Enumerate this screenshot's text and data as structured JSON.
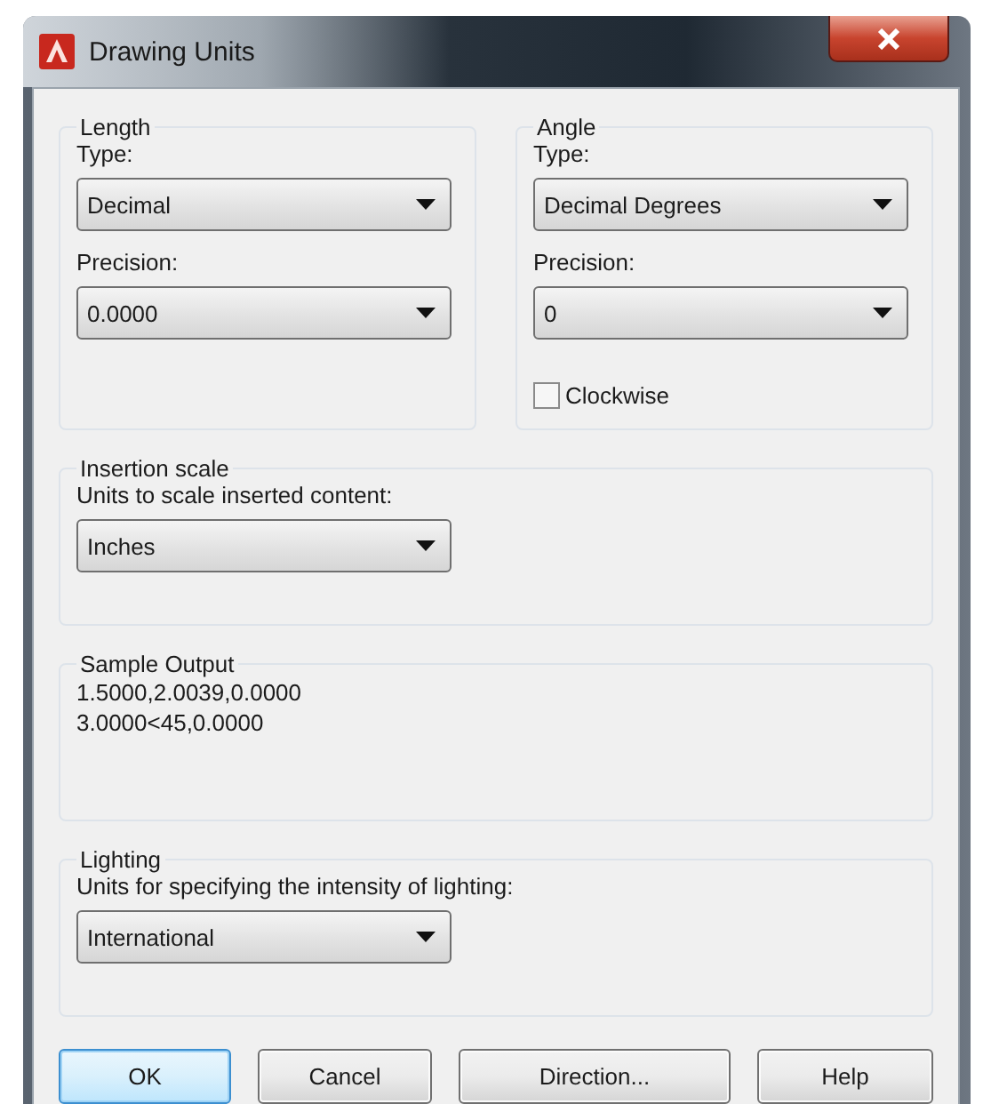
{
  "window": {
    "title": "Drawing Units"
  },
  "length": {
    "heading": "Length",
    "type_label": "Type:",
    "type_value": "Decimal",
    "precision_label": "Precision:",
    "precision_value": "0.0000"
  },
  "angle": {
    "heading": "Angle",
    "type_label": "Type:",
    "type_value": "Decimal Degrees",
    "precision_label": "Precision:",
    "precision_value": "0",
    "clockwise": {
      "label": "Clockwise",
      "checked": false
    }
  },
  "insertion_scale": {
    "heading": "Insertion scale",
    "label": "Units to scale inserted content:",
    "value": "Inches"
  },
  "sample_output": {
    "heading": "Sample Output",
    "lines": [
      "1.5000,2.0039,0.0000",
      "3.0000<45,0.0000"
    ]
  },
  "lighting": {
    "heading": "Lighting",
    "label": "Units for specifying the intensity of lighting:",
    "value": "International"
  },
  "buttons": [
    {
      "label": "OK",
      "default": true
    },
    {
      "label": "Cancel",
      "default": false
    },
    {
      "label": "Direction...",
      "default": false
    },
    {
      "label": "Help",
      "default": false
    }
  ]
}
